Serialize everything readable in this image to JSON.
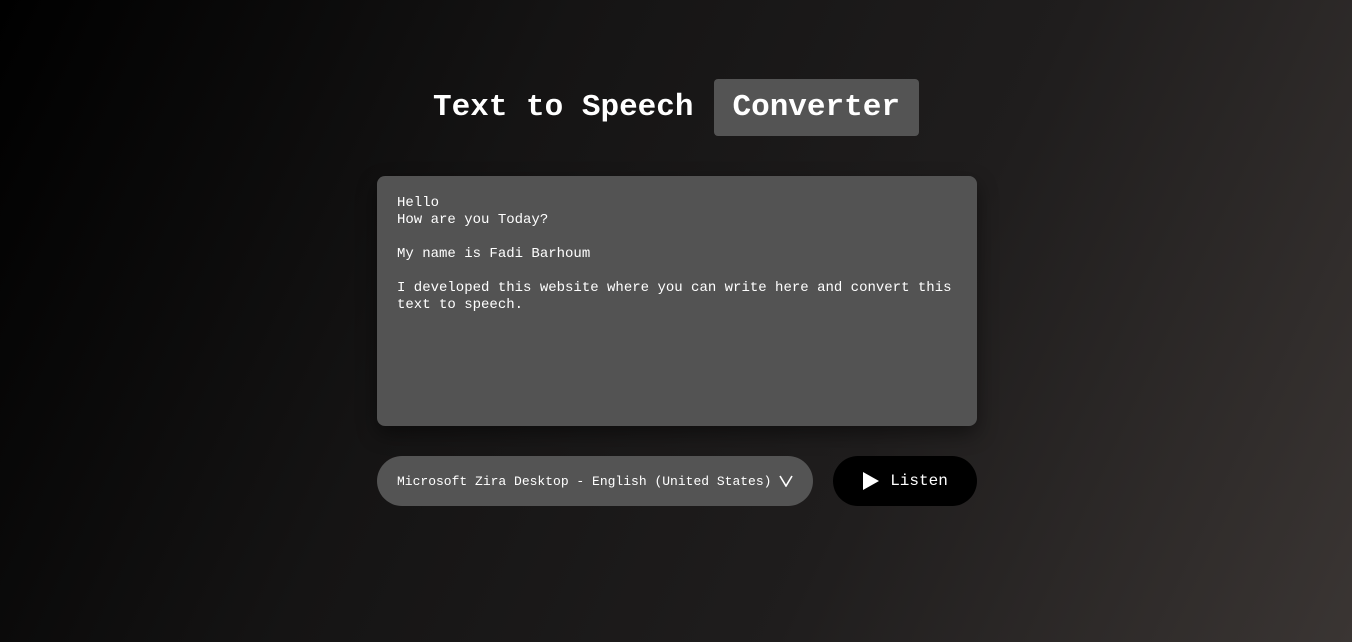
{
  "header": {
    "title_main": "Text to Speech",
    "title_highlight": "Converter"
  },
  "editor": {
    "text": "Hello\nHow are you Today?\n\nMy name is Fadi Barhoum\n\nI developed this website where you can write here and convert this text to speech."
  },
  "controls": {
    "voice_selected": "Microsoft Zira Desktop - English (United States)",
    "voice_icon": "chevron-down-icon",
    "listen_label": "Listen",
    "listen_icon": "play-icon"
  },
  "colors": {
    "panel": "#545454",
    "button": "#000000",
    "text": "#ffffff"
  }
}
